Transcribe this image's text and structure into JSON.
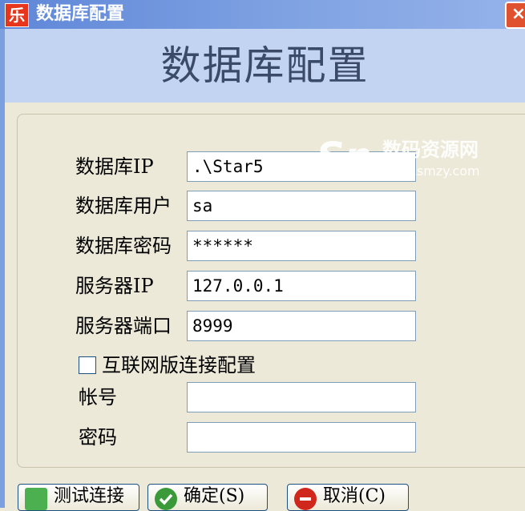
{
  "window": {
    "app_icon_text": "乐",
    "title": "数据库配置",
    "close_glyph": "×"
  },
  "banner": {
    "title": "数据库配置"
  },
  "form": {
    "db_ip": {
      "label": "数据库IP",
      "value": ".\\Star5"
    },
    "db_user": {
      "label": "数据库用户",
      "value": "sa"
    },
    "db_password": {
      "label": "数据库密码",
      "value": "******"
    },
    "server_ip": {
      "label": "服务器IP",
      "value": "127.0.0.1"
    },
    "server_port": {
      "label": "服务器端口",
      "value": "8999"
    },
    "internet_checkbox": {
      "label": "互联网版连接配置",
      "checked": false
    },
    "account": {
      "label": "帐号",
      "value": ""
    },
    "password": {
      "label": "密码",
      "value": ""
    }
  },
  "buttons": {
    "test": {
      "label": "测试连接",
      "icon": "plug-icon",
      "color": "#4caf50"
    },
    "ok": {
      "label": "确定(S)",
      "icon": "check-icon",
      "color": "#3a9a3a"
    },
    "cancel": {
      "label": "取消(C)",
      "icon": "no-entry-icon",
      "color": "#d0281c"
    }
  },
  "watermark": {
    "logo": "Sn",
    "text": "数码资源网",
    "url": "www.smzy.com"
  }
}
